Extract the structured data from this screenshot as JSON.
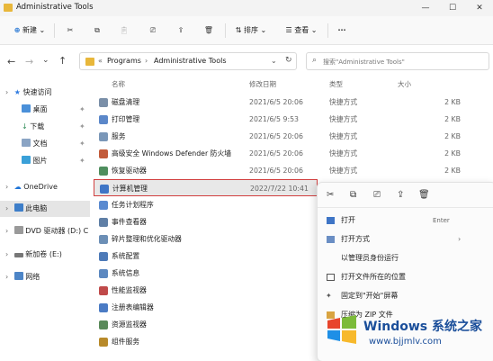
{
  "window": {
    "title": "Administrative Tools"
  },
  "toolbar": {
    "new_label": "新建",
    "sort_label": "排序",
    "view_label": "查看",
    "more_label": "···"
  },
  "address": {
    "chev": "«",
    "crumb1": "Programs",
    "crumb2": "Administrative Tools"
  },
  "search": {
    "placeholder": "搜索\"Administrative Tools\""
  },
  "sidebar": {
    "quick": "快速访问",
    "items": [
      {
        "label": "桌面"
      },
      {
        "label": "下载"
      },
      {
        "label": "文档"
      },
      {
        "label": "图片"
      }
    ],
    "onedrive": "OneDrive",
    "thispc": "此电脑",
    "dvd": "DVD 驱动器 (D:) C",
    "newvol": "新加卷 (E:)",
    "network": "网络"
  },
  "columns": {
    "name": "名称",
    "date": "修改日期",
    "type": "类型",
    "size": "大小"
  },
  "files": [
    {
      "name": "磁盘清理",
      "date": "2021/6/5 20:06",
      "type": "快捷方式",
      "size": "2 KB",
      "color": "#7a8fa8"
    },
    {
      "name": "打印管理",
      "date": "2021/6/5 9:53",
      "type": "快捷方式",
      "size": "2 KB",
      "color": "#5b87c9"
    },
    {
      "name": "服务",
      "date": "2021/6/5 20:06",
      "type": "快捷方式",
      "size": "2 KB",
      "color": "#7a97b8"
    },
    {
      "name": "高级安全 Windows Defender 防火墙",
      "date": "2021/6/5 20:06",
      "type": "快捷方式",
      "size": "2 KB",
      "color": "#c25b3a"
    },
    {
      "name": "恢复驱动器",
      "date": "2021/6/5 20:06",
      "type": "快捷方式",
      "size": "2 KB",
      "color": "#4f8e5e"
    },
    {
      "name": "计算机管理",
      "date": "2022/7/22 10:41",
      "type": "",
      "size": "",
      "color": "#3f75c6"
    },
    {
      "name": "任务计划程序",
      "date": "",
      "type": "",
      "size": "",
      "color": "#5a8ad0"
    },
    {
      "name": "事件查看器",
      "date": "",
      "type": "",
      "size": "",
      "color": "#5f7fa6"
    },
    {
      "name": "碎片整理和优化驱动器",
      "date": "",
      "type": "",
      "size": "",
      "color": "#6c8fb6"
    },
    {
      "name": "系统配置",
      "date": "",
      "type": "",
      "size": "",
      "color": "#4d7ab8"
    },
    {
      "name": "系统信息",
      "date": "",
      "type": "",
      "size": "",
      "color": "#5c88c0"
    },
    {
      "name": "性能监视器",
      "date": "",
      "type": "",
      "size": "",
      "color": "#c04a4a"
    },
    {
      "name": "注册表编辑器",
      "date": "",
      "type": "",
      "size": "",
      "color": "#4b7bc4"
    },
    {
      "name": "资源监视器",
      "date": "",
      "type": "",
      "size": "",
      "color": "#5a8a5a"
    },
    {
      "name": "组件服务",
      "date": "",
      "type": "",
      "size": "",
      "color": "#b88a2a"
    }
  ],
  "context": {
    "open": "打开",
    "open_key": "Enter",
    "open_with": "打开方式",
    "run_admin": "以管理员身份运行",
    "open_location": "打开文件所在的位置",
    "pin_start": "固定到\"开始\"屏幕",
    "compress": "压缩为 ZIP 文件"
  },
  "watermark": {
    "title": "Windows 系统之家",
    "url": "www.bjjmlv.com"
  }
}
